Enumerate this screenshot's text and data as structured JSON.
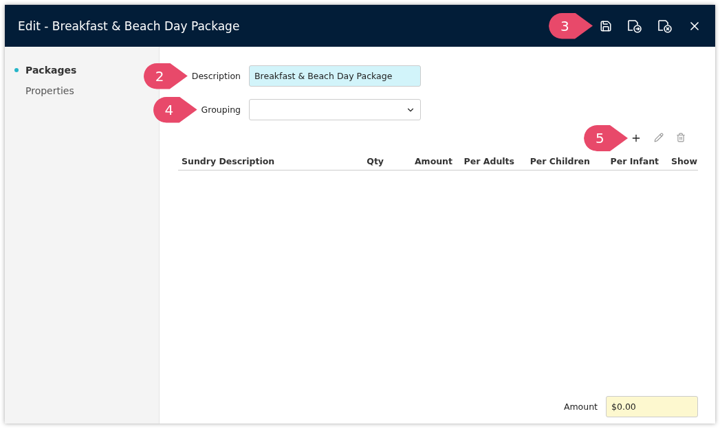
{
  "window": {
    "title": "Edit - Breakfast & Beach Day Package"
  },
  "header_actions": [
    {
      "kind": "save",
      "callout": "3"
    },
    {
      "kind": "save-next"
    },
    {
      "kind": "save-close"
    },
    {
      "kind": "close"
    }
  ],
  "sidebar": {
    "items": [
      {
        "label": "Packages",
        "selected": true
      },
      {
        "label": "Properties",
        "selected": false
      }
    ]
  },
  "form": {
    "fields": [
      {
        "kind": "text",
        "label": "Description",
        "value": "Breakfast & Beach Day Package",
        "callout": "2"
      },
      {
        "kind": "select",
        "label": "Grouping",
        "callout": "4"
      }
    ]
  },
  "toolbar": [
    {
      "kind": "add",
      "disabled": false,
      "callout": "5"
    },
    {
      "kind": "edit",
      "disabled": true
    },
    {
      "kind": "delete",
      "disabled": true
    }
  ],
  "table": {
    "columns": [
      "Sundry Description",
      "Qty",
      "Amount",
      "Per Adults",
      "Per Children",
      "Per Infant",
      "Show"
    ]
  },
  "footer": {
    "label": "Amount",
    "value": "$0.00"
  }
}
